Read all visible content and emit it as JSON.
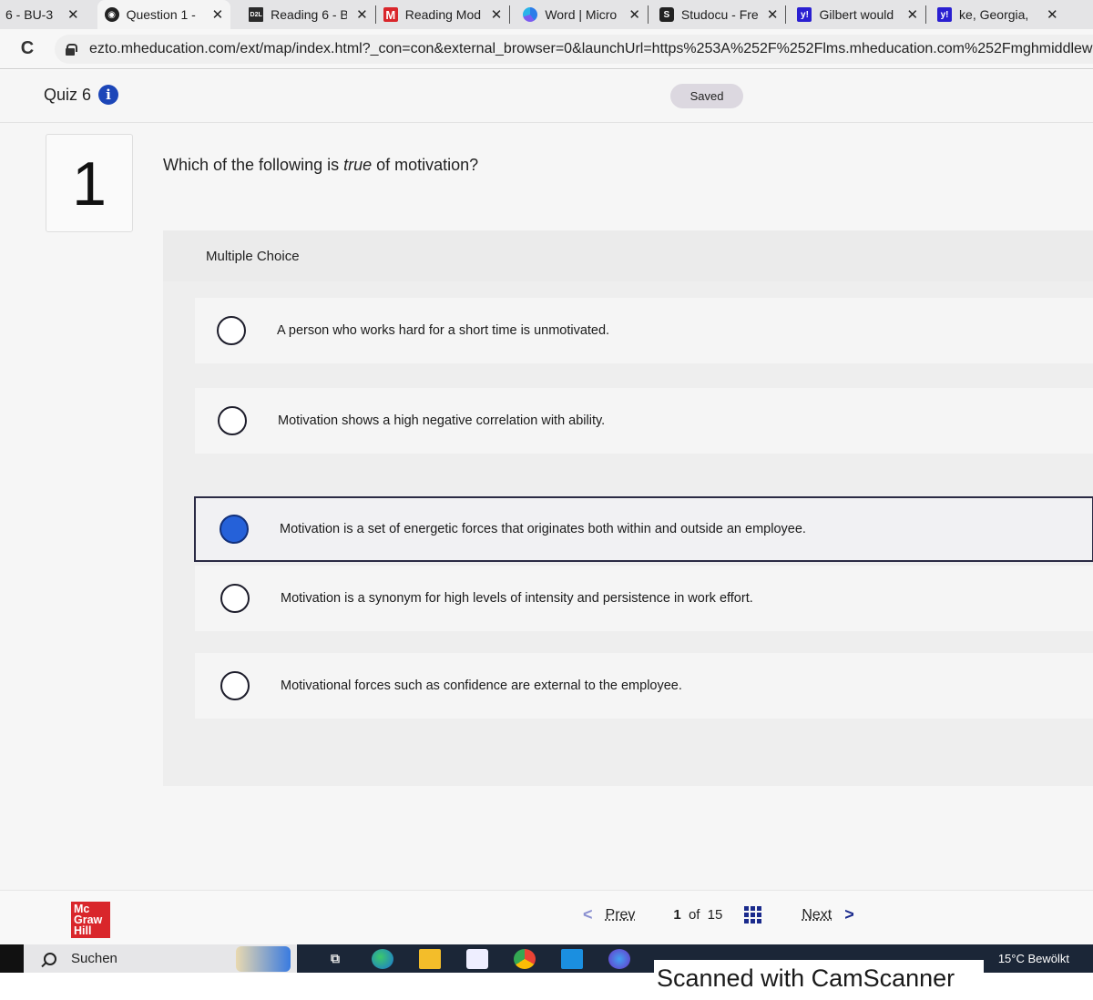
{
  "browser": {
    "tabs": [
      {
        "title": "6 - BU-3",
        "icon": "partial-tab-icon",
        "active": false
      },
      {
        "title": "Question 1 -",
        "icon": "globe-icon",
        "active": true
      },
      {
        "title": "Reading 6 - B",
        "icon": "d2l-icon",
        "fav_text": "D2L",
        "active": false
      },
      {
        "title": "Reading Mod",
        "icon": "mcgraw-hill-icon",
        "fav_text": "M",
        "active": false
      },
      {
        "title": "Word | Micro",
        "icon": "copilot-icon",
        "active": false
      },
      {
        "title": "Studocu - Fre",
        "icon": "studocu-icon",
        "active": false
      },
      {
        "title": "Gilbert would",
        "icon": "yahoo-icon",
        "fav_text": "y!",
        "active": false
      },
      {
        "title": "ke, Georgia,",
        "icon": "yahoo-icon",
        "fav_text": "y!",
        "active": false
      }
    ],
    "close_glyph": "✕",
    "reload_glyph": "C",
    "url": "ezto.mheducation.com/ext/map/index.html?_con=con&external_browser=0&launchUrl=https%253A%252F%252Flms.mheducation.com%252Fmghmiddlew"
  },
  "quiz": {
    "title": "Quiz 6",
    "info_glyph": "i",
    "save_status": "Saved",
    "question_number": "1",
    "question_prefix": "Which of the following is ",
    "question_emphasis": "true",
    "question_suffix": " of motivation?",
    "question_type": "Multiple Choice",
    "choices": [
      {
        "text": "A person who works hard for a short time is unmotivated.",
        "selected": false
      },
      {
        "text": "Motivation shows a high negative correlation with ability.",
        "selected": false
      },
      {
        "text": "Motivation is a set of energetic forces that originates both within and outside an employee.",
        "selected": true
      },
      {
        "text": "Motivation is a synonym for high levels of intensity and persistence in work effort.",
        "selected": false
      },
      {
        "text": "Motivational forces such as confidence are external to the employee.",
        "selected": false
      }
    ]
  },
  "footer": {
    "logo_lines": [
      "Mc",
      "Graw",
      "Hill"
    ],
    "prev_label": "Prev",
    "next_label": "Next",
    "current_page": "1",
    "of_label": "of",
    "total_pages": "15",
    "chev_left": "<",
    "chev_right": ">"
  },
  "taskbar": {
    "search_label": "Suchen",
    "taskview_glyph": "⧉",
    "weather": "15°C  Bewölkt"
  },
  "watermark": "Scanned with CamScanner"
}
